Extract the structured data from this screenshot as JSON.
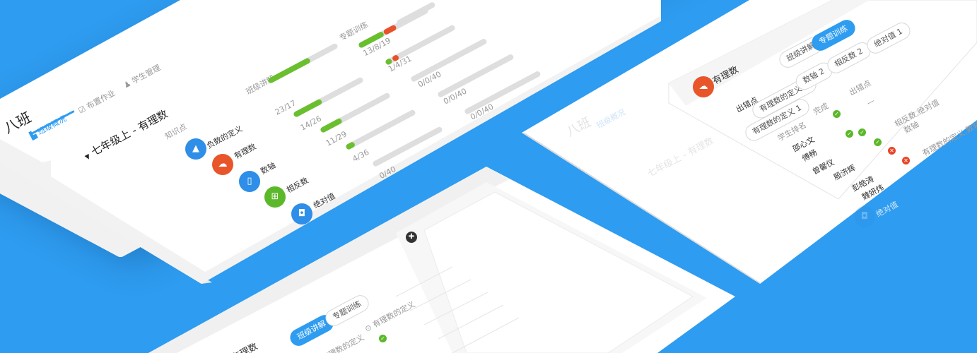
{
  "main": {
    "class_title": "八班",
    "nav": [
      {
        "label": "班级概况",
        "icon": "chart-icon"
      },
      {
        "label": "布置作业",
        "icon": "edit-icon"
      },
      {
        "label": "学生管理",
        "icon": "people-icon"
      }
    ],
    "unit_title": "七年级上 - 有理数",
    "col_knowledge": "知识点",
    "col_class_practice": "班级讲解",
    "col_topic_practice": "专题训练",
    "rows": [
      {
        "name": "负数的定义",
        "icon": "drop-icon",
        "class_value": "",
        "class_ratio": 0.0,
        "topic_value": "13/8/19",
        "topic_ratio": 0.55,
        "topic_red": 0.25
      },
      {
        "name": "有理数",
        "icon": "cloud-icon",
        "class_value": "23/17",
        "class_ratio": 0.6,
        "topic_value": "1/4/31",
        "topic_ratio": 0.12,
        "topic_red": 0.12
      },
      {
        "name": "数轴",
        "icon": "book-icon",
        "class_value": "14/26",
        "class_ratio": 0.4,
        "topic_value": "0/0/40",
        "topic_ratio": 0.0,
        "topic_red": 0.0
      },
      {
        "name": "相反数",
        "icon": "grid-icon",
        "class_value": "11/29",
        "class_ratio": 0.3,
        "topic_value": "0/0/40",
        "topic_ratio": 0.0,
        "topic_red": 0.0
      },
      {
        "name": "绝对值",
        "icon": "camera-icon",
        "class_value": "4/36",
        "class_ratio": 0.1,
        "topic_value": "0/0/40",
        "topic_ratio": 0.0,
        "topic_red": 0.0
      },
      {
        "name": "",
        "icon": "",
        "class_value": "0/40",
        "class_ratio": 0.0,
        "topic_value": "",
        "topic_ratio": 0.0,
        "topic_red": 0.0
      }
    ]
  },
  "right": {
    "class_title": "八班",
    "nav_label": "班级概况",
    "unit_title": "七年级上 - 有理数",
    "item_title": "有理数",
    "tabs": [
      "班级讲解",
      "专题训练"
    ],
    "filters": [
      "有理数的定义 1",
      "数轴 2",
      "相反数 2",
      "绝对值 1"
    ],
    "wrong_label": "出错点",
    "wrong_value": "有理数的定义 1",
    "headers": [
      "学生排名",
      "完成",
      "出错点"
    ],
    "students": [
      {
        "name": "邵心文",
        "status": "ok",
        "note": "—"
      },
      {
        "name": "傅畅",
        "status": "ok",
        "note": "相反数,绝对值"
      },
      {
        "name": "曾馨仪",
        "status": "ok",
        "note": "数轴"
      },
      {
        "name": "殷济辉",
        "status": "no",
        "note": "有理数的定义,数轴"
      },
      {
        "name": "彭皓涛",
        "status": "no",
        "note": ""
      },
      {
        "name": "魏妍炜",
        "status": "",
        "note": ""
      }
    ],
    "bottom_label": "绝对值"
  },
  "bottom": {
    "item_title": "有理数",
    "tabs": [
      "班级讲解",
      "专题训练"
    ],
    "filter_label": "有理数的定义",
    "sub_label": "有理数的定义"
  }
}
